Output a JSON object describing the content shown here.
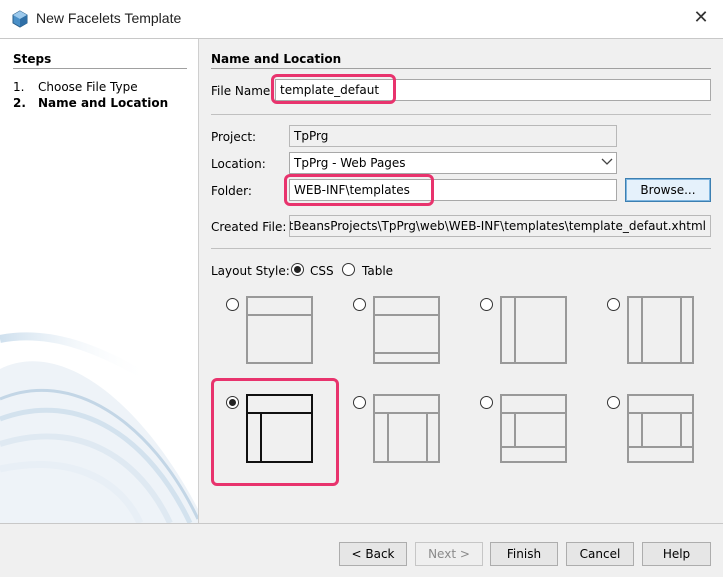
{
  "window": {
    "title": "New Facelets Template",
    "close_glyph": "✕"
  },
  "steps": {
    "title": "Steps",
    "items": [
      {
        "num": "1.",
        "label": "Choose File Type",
        "current": false
      },
      {
        "num": "2.",
        "label": "Name and Location",
        "current": true
      }
    ]
  },
  "form": {
    "section_title": "Name and Location",
    "file_name": {
      "label": "File Name:",
      "value": "template_defaut"
    },
    "project": {
      "label": "Project:",
      "value": "TpPrg"
    },
    "location": {
      "label": "Location:",
      "value": "TpPrg - Web Pages"
    },
    "folder": {
      "label": "Folder:",
      "value": "WEB-INF\\templates",
      "browse_label": "Browse..."
    },
    "created_file": {
      "label": "Created File:",
      "value": "NetBeansProjects\\TpPrg\\web\\WEB-INF\\templates\\template_defaut.xhtml"
    },
    "layout_style": {
      "label": "Layout Style:",
      "options": [
        "CSS",
        "Table"
      ],
      "selected": "CSS"
    }
  },
  "layouts": {
    "selected_index": 4,
    "count": 8
  },
  "buttons": {
    "back": "< Back",
    "next": "Next >",
    "finish": "Finish",
    "cancel": "Cancel",
    "help": "Help"
  },
  "colors": {
    "highlight": "#e8336d",
    "panel": "#f0f0f0"
  },
  "icons": {
    "app": "netbeans-cube-icon",
    "close": "close-icon",
    "dropdown": "chevron-down-icon"
  }
}
